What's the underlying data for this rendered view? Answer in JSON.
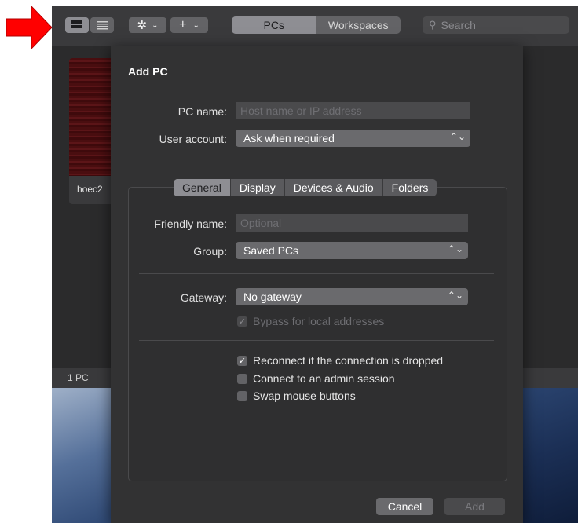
{
  "toolbar": {
    "grid_view_icon": "grid-icon",
    "list_view_icon": "list-icon",
    "settings_icon": "gear-icon",
    "add_icon": "plus-icon",
    "tabs": [
      {
        "label": "PCs",
        "active": true
      },
      {
        "label": "Workspaces",
        "active": false
      }
    ],
    "search_placeholder": "Search"
  },
  "background": {
    "pc_label": "hoec2",
    "status_text": "1 PC"
  },
  "sheet": {
    "title": "Add PC",
    "pc_name_label": "PC name:",
    "pc_name_placeholder": "Host name or IP address",
    "user_account_label": "User account:",
    "user_account_value": "Ask when required",
    "tabs": [
      {
        "label": "General",
        "active": true
      },
      {
        "label": "Display",
        "active": false
      },
      {
        "label": "Devices & Audio",
        "active": false
      },
      {
        "label": "Folders",
        "active": false
      }
    ],
    "friendly_name_label": "Friendly name:",
    "friendly_name_placeholder": "Optional",
    "group_label": "Group:",
    "group_value": "Saved PCs",
    "gateway_label": "Gateway:",
    "gateway_value": "No gateway",
    "bypass_label": "Bypass for local addresses",
    "reconnect_label": "Reconnect if the connection is dropped",
    "admin_label": "Connect to an admin session",
    "swap_label": "Swap mouse buttons",
    "cancel_label": "Cancel",
    "add_label": "Add"
  },
  "colors": {
    "arrow": "#ff0000",
    "window_bg": "#2b2b2c",
    "sheet_bg": "#323233"
  }
}
